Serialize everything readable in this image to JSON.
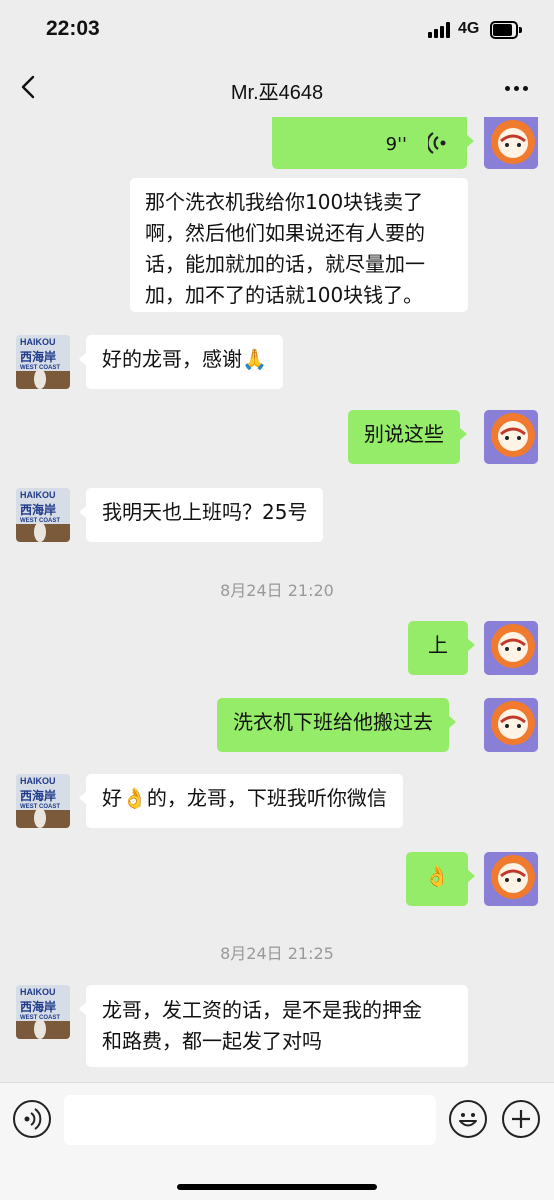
{
  "status": {
    "time": "22:03",
    "network": "4G"
  },
  "nav": {
    "title": "Mr.巫4648"
  },
  "messages": {
    "m1_voice_duration": "9''",
    "m2": "那个洗衣机我给你100块钱卖了啊，然后他们如果说还有人要的话，能加就加的话，就尽量加一加，加不了的话就100块钱了。",
    "m2_lines": [
      "那个洗衣机我给你100块钱卖了",
      "啊，然后他们如果说还有人要的",
      "话，能加就加的话，就尽量加一",
      "加，加不了的话就100块钱了。"
    ],
    "m3": "好的龙哥，感谢🙏",
    "m4": "别说这些",
    "m5": "我明天也上班吗？25号",
    "ts1": "8月24日 21:20",
    "m6": "上",
    "m7": "洗衣机下班给他搬过去",
    "m8": "好👌的，龙哥，下班我听你微信",
    "m9": "👌",
    "ts2": "8月24日 21:25",
    "m10_lines": [
      "龙哥，发工资的话，是不是我的押金",
      "和路费，都一起发了对吗"
    ]
  },
  "contact_avatar": {
    "line1": "HAIKOU",
    "line2": "西海岸",
    "line3": "WEST COAST"
  },
  "icons": {
    "back": "chevron-left-icon",
    "more": "more-dots-icon",
    "voice": "voice-input-icon",
    "emoji": "emoji-icon",
    "plus": "plus-icon",
    "voice_wave": "voice-wave-icon"
  },
  "colors": {
    "background": "#ededed",
    "bubble_out": "#95ec69",
    "bubble_in": "#ffffff",
    "timestamp": "#999999"
  }
}
